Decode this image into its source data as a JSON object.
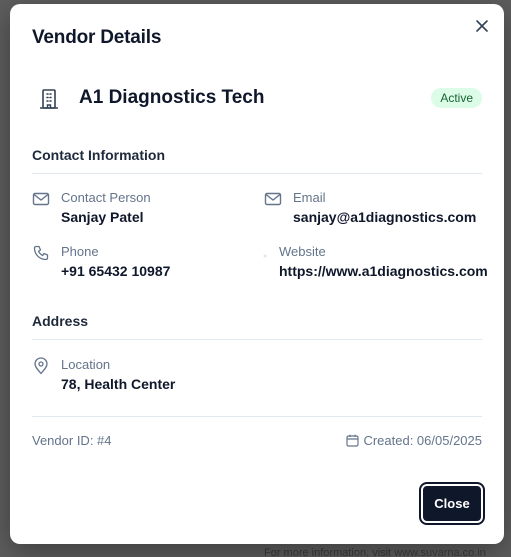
{
  "backdrop": {
    "footer_fragment": "For more information, visit www.suvarna.co.in"
  },
  "modal": {
    "title": "Vendor Details",
    "close_icon": "x-icon"
  },
  "vendor": {
    "icon": "building-icon",
    "name": "A1 Diagnostics Tech",
    "status": "Active",
    "status_color": "#dcfce7"
  },
  "contact": {
    "section_title": "Contact Information",
    "contact_person": {
      "icon": "mail-icon",
      "label": "Contact Person",
      "value": "Sanjay Patel"
    },
    "email": {
      "icon": "mail-icon",
      "label": "Email",
      "value": "sanjay@a1diagnostics.com"
    },
    "phone": {
      "icon": "phone-icon",
      "label": "Phone",
      "value": "+91 65432 10987"
    },
    "website": {
      "icon": "globe-icon",
      "label": "Website",
      "value": "https://www.a1diagnostics.com"
    }
  },
  "address": {
    "section_title": "Address",
    "location": {
      "icon": "map-pin-icon",
      "label": "Location",
      "value": "78, Health Center"
    }
  },
  "footer": {
    "vendor_id": "Vendor ID: #4",
    "created": "Created: 06/05/2025",
    "close_label": "Close"
  },
  "colors": {
    "primary": "#0f172a",
    "muted": "#64748b",
    "badge_text": "#166534"
  }
}
